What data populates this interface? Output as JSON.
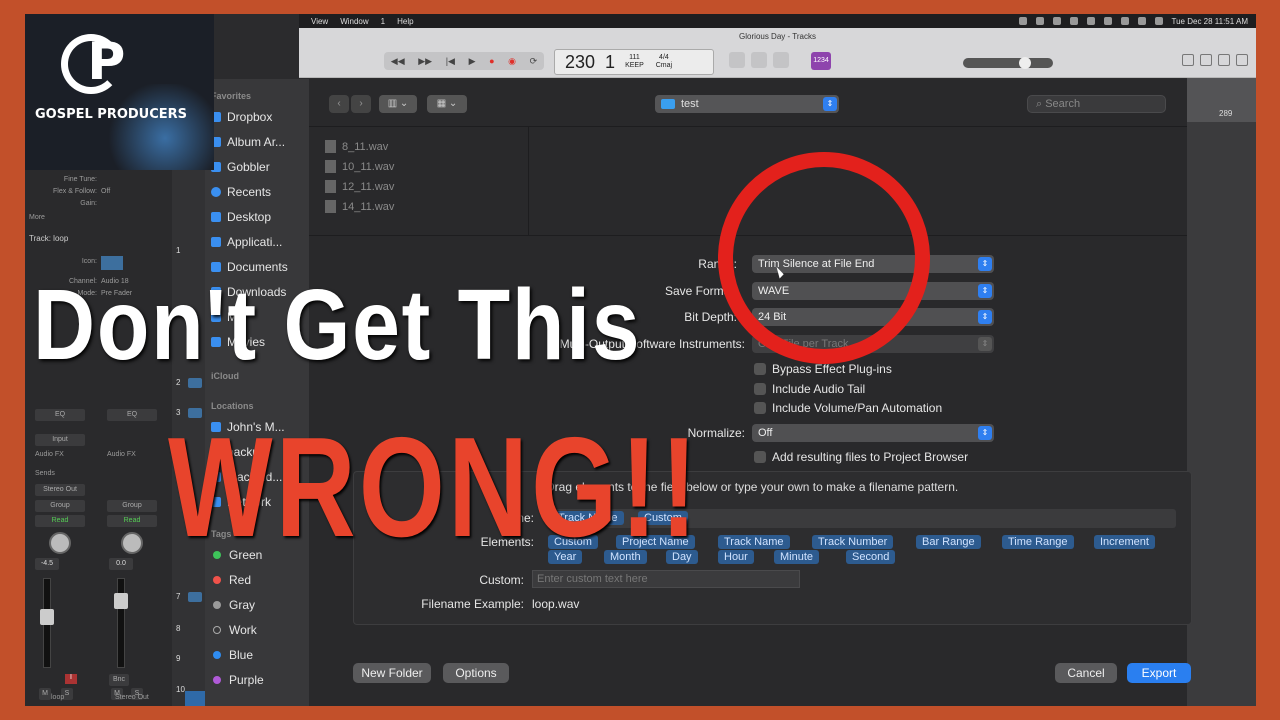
{
  "menubar": {
    "items": [
      "View",
      "Window",
      "1",
      "Help"
    ],
    "datetime": "Tue Dec 28  11:51 AM"
  },
  "window_title": "Glorious Day - Tracks",
  "lcd": {
    "bar": "230",
    "beat": "1",
    "tempo": "111",
    "tempo_label": "KEEP",
    "signature": "4/4",
    "key": "Cmaj"
  },
  "purple_badge": "1234",
  "ruler_number": "289",
  "inspector": {
    "fine_tune": "Fine Tune:",
    "flex_follow": "Flex & Follow:",
    "flex_value": "Off",
    "gain": "Gain:",
    "more": "More",
    "track_label": "Track:",
    "track_name": "loop",
    "icon_label": "Icon:",
    "channel_label": "Channel:",
    "channel_value": "Audio 18",
    "mode_label": "Mode:",
    "mode_value": "Pre Fader",
    "eq": "EQ",
    "input": "Input",
    "audio_fx": "Audio FX",
    "sends": "Sends",
    "stereo_out": "Stereo Out",
    "group": "Group",
    "read": "Read",
    "vol1": "-4.5",
    "vol2": "0.0",
    "bnc": "Bnc",
    "ch1_name": "loop",
    "ch2_name": "Stereo Out",
    "mute": "M",
    "solo": "S",
    "rec": "R",
    "input_mon": "I"
  },
  "track_numbers": [
    "1",
    "2",
    "3",
    "7",
    "8",
    "9",
    "10"
  ],
  "sidebar": {
    "favorites_header": "Favorites",
    "favorites": [
      "Dropbox",
      "Album Ar...",
      "Gobbler",
      "Recents",
      "Desktop",
      "Applicati...",
      "Documents",
      "Downloads",
      "M...",
      "Movies"
    ],
    "icloud_header": "iCloud",
    "locations_header": "Locations",
    "locations": [
      "John's M...",
      "backup",
      "Macloud...",
      "Network"
    ],
    "tags_header": "Tags",
    "tags": [
      {
        "name": "Green",
        "color": "#3ec35a"
      },
      {
        "name": "Red",
        "color": "#f0524a"
      },
      {
        "name": "Gray",
        "color": "#9a9a9a"
      },
      {
        "name": "Work",
        "color": "transparent"
      },
      {
        "name": "Blue",
        "color": "#2f8cf0"
      },
      {
        "name": "Purple",
        "color": "#b05ad8"
      }
    ]
  },
  "dialog": {
    "folder": "test",
    "search_placeholder": "Search",
    "files": [
      "8_11.wav",
      "10_11.wav",
      "12_11.wav",
      "14_11.wav"
    ],
    "range_label": "Range:",
    "range_value": "Trim Silence at File End",
    "format_label": "Save Format:",
    "format_value": "WAVE",
    "bitdepth_label": "Bit Depth:",
    "bitdepth_value": "24 Bit",
    "multi_label": "Multi-Output Software Instruments:",
    "multi_value": "One File per Track",
    "bypass_label": "Bypass Effect Plug-ins",
    "tail_label": "Include Audio Tail",
    "volpan_label": "Include Volume/Pan Automation",
    "normalize_label": "Normalize:",
    "normalize_value": "Off",
    "addfiles_label": "Add resulting files to Project Browser",
    "pattern_hint": "Drag elements to the field below or type your own to make a filename pattern.",
    "name_label": "Name:",
    "name_tokens": [
      "Track Name",
      "Custom"
    ],
    "elements_label": "Elements:",
    "elements_row1": [
      "Custom",
      "Project Name",
      "Track Name",
      "Track Number",
      "Bar Range",
      "Time Range",
      "Increment"
    ],
    "elements_row2": [
      "Year",
      "Month",
      "Day",
      "Hour",
      "Minute",
      "Second"
    ],
    "custom_label": "Custom:",
    "custom_placeholder": "Enter custom text here",
    "example_label": "Filename Example:",
    "example_value": "loop.wav",
    "new_folder": "New Folder",
    "options": "Options",
    "cancel": "Cancel",
    "export": "Export"
  },
  "overlay": {
    "brand": "GOSPEL PRODUCERS",
    "line1": "Don't Get This",
    "line2": "WRONG!!"
  },
  "colors": {
    "accent": "#2a7ff0",
    "headline_red": "#e8442c",
    "circle_red": "#e3211c",
    "border_orange": "#c2502a"
  }
}
